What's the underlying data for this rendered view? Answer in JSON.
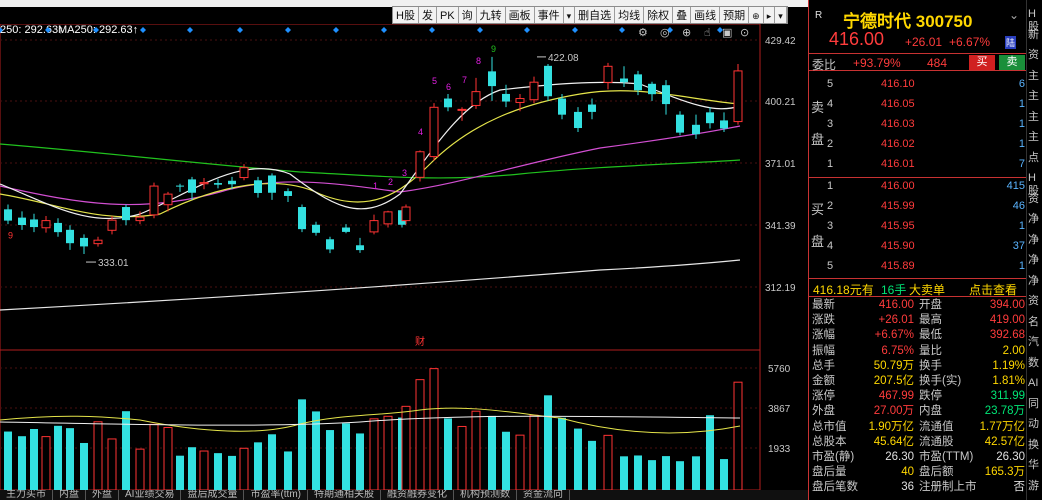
{
  "toolbar": {
    "items": [
      "H股",
      "发",
      "PK",
      "询",
      "九转",
      "画板",
      "事件",
      "▾",
      "删自选",
      "均线",
      "除权",
      "叠",
      "画线",
      "预期",
      "⊕",
      "▸",
      "▾"
    ]
  },
  "ma_labels": [
    {
      "text": "250: 292.63↑",
      "color": "#ffffff"
    },
    {
      "text": "MA250: 292.63↑",
      "color": "#ffffff"
    }
  ],
  "price_axis": [
    "429.42",
    "400.21",
    "371.01",
    "341.39",
    "312.19"
  ],
  "volume_axis": [
    "5760",
    "3867",
    "1933"
  ],
  "annotations": {
    "high": "422.08",
    "low": "333.01",
    "marker": "财",
    "seq_top": [
      "1",
      "2",
      "3",
      "4",
      "5",
      "6",
      "7",
      "8",
      "9"
    ],
    "seq_left": "9"
  },
  "bottom_tabs": [
    "主力买市",
    "内盘",
    "外盘",
    "AI业绩交易",
    "盘后成交量",
    "市盈率(ttm)",
    "特期通相关股",
    "融资融券变化",
    "机构预测数",
    "资金流向"
  ],
  "stock": {
    "r_mark": "R",
    "name": "宁德时代",
    "code": "300750",
    "price": "416.00",
    "change": "+26.01",
    "change_pct": "+6.67%",
    "tag": "陆",
    "ratio_label": "委比",
    "ratio_pct": "+93.79%",
    "ratio_val": "484",
    "buy_label": "买",
    "sell_label": "卖"
  },
  "sell_book": {
    "side_label": "卖盘",
    "rows": [
      {
        "level": "5",
        "price": "416.10",
        "volume": "6"
      },
      {
        "level": "4",
        "price": "416.05",
        "volume": "1"
      },
      {
        "level": "3",
        "price": "416.03",
        "volume": "1"
      },
      {
        "level": "2",
        "price": "416.02",
        "volume": "1"
      },
      {
        "level": "1",
        "price": "416.01",
        "volume": "7"
      }
    ]
  },
  "buy_book": {
    "side_label": "买盘",
    "rows": [
      {
        "level": "1",
        "price": "416.00",
        "volume": "415"
      },
      {
        "level": "2",
        "price": "415.99",
        "volume": "46"
      },
      {
        "level": "3",
        "price": "415.95",
        "volume": "1"
      },
      {
        "level": "4",
        "price": "415.90",
        "volume": "37"
      },
      {
        "level": "5",
        "price": "415.89",
        "volume": "1"
      }
    ]
  },
  "ticker": {
    "price": "416.18元有",
    "hands": "16手",
    "order": "大卖单",
    "link": "点击查看"
  },
  "stats": [
    {
      "l1": "最新",
      "v1": "416.00",
      "l2": "开盘",
      "v2": "394.00"
    },
    {
      "l1": "涨跌",
      "v1": "+26.01",
      "l2": "最高",
      "v2": "419.00"
    },
    {
      "l1": "涨幅",
      "v1": "+6.67%",
      "l2": "最低",
      "v2": "392.68"
    },
    {
      "l1": "振幅",
      "v1": "6.75%",
      "l2": "量比",
      "v2": "2.00"
    },
    {
      "l1": "总手",
      "v1": "50.79万",
      "l2": "换手",
      "v2": "1.19%"
    },
    {
      "l1": "金额",
      "v1": "207.5亿",
      "l2": "换手(实)",
      "v2": "1.81%"
    },
    {
      "l1": "涨停",
      "v1": "467.99",
      "l2": "跌停",
      "v2": "311.99"
    },
    {
      "l1": "外盘",
      "v1": "27.00万",
      "l2": "内盘",
      "v2": "23.78万"
    },
    {
      "l1": "总市值",
      "v1": "1.90万亿",
      "l2": "流通值",
      "v2": "1.77万亿"
    },
    {
      "l1": "总股本",
      "v1": "45.64亿",
      "l2": "流通股",
      "v2": "42.57亿"
    },
    {
      "l1": "市盈(静)",
      "v1": "26.30",
      "l2": "市盈(TTM)",
      "v2": "26.30"
    },
    {
      "l1": "盘后量",
      "v1": "40",
      "l2": "盘后额",
      "v2": "165.3万"
    },
    {
      "l1": "盘后笔数",
      "v1": "36",
      "l2": "注册制上市",
      "v2": "否"
    }
  ],
  "side_strip": [
    "H股",
    "新",
    "资",
    "主",
    "主",
    "主",
    "主",
    "点",
    "H股",
    "资",
    "净",
    "净",
    "净",
    "净",
    "资",
    "名",
    "汽",
    "数",
    "AI",
    "同",
    "动",
    "换",
    "华",
    "游"
  ]
}
